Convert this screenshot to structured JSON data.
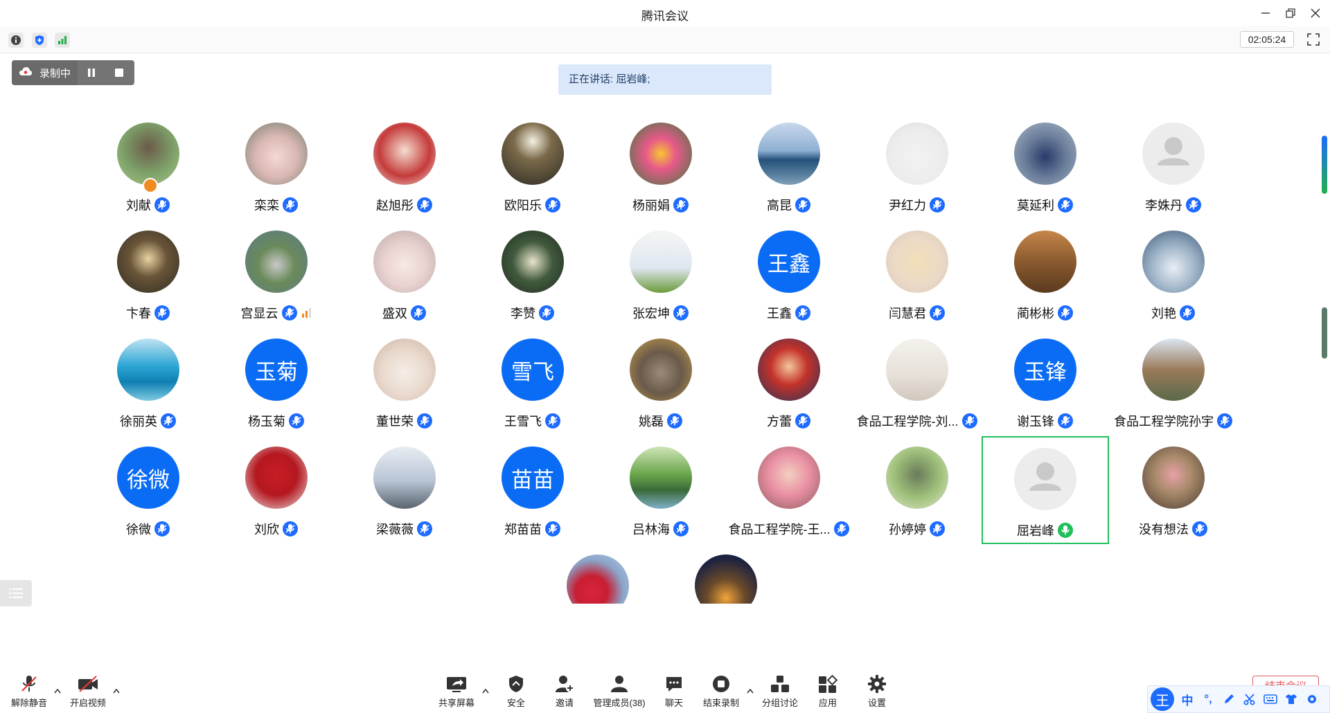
{
  "window": {
    "title": "腾讯会议"
  },
  "toolbar": {
    "timer": "02:05:24"
  },
  "recording": {
    "label": "录制中"
  },
  "speaking": {
    "text": "正在讲话: 屈岩峰;"
  },
  "participants": [
    {
      "name": "刘献"
    },
    {
      "name": "栾栾"
    },
    {
      "name": "赵旭彤"
    },
    {
      "name": "欧阳乐"
    },
    {
      "name": "杨丽娟"
    },
    {
      "name": "高昆"
    },
    {
      "name": "尹红力"
    },
    {
      "name": "莫延利"
    },
    {
      "name": "李姝丹"
    },
    {
      "name": "卞春"
    },
    {
      "name": "宫显云"
    },
    {
      "name": "盛双"
    },
    {
      "name": "李赞"
    },
    {
      "name": "张宏坤"
    },
    {
      "name": "王鑫",
      "avatar_text": "王鑫"
    },
    {
      "name": "闫慧君"
    },
    {
      "name": "蔺彬彬"
    },
    {
      "name": "刘艳"
    },
    {
      "name": "徐丽英"
    },
    {
      "name": "杨玉菊",
      "avatar_text": "玉菊"
    },
    {
      "name": "董世荣"
    },
    {
      "name": "王雪飞",
      "avatar_text": "雪飞"
    },
    {
      "name": "姚磊"
    },
    {
      "name": "方蕾"
    },
    {
      "name": "食品工程学院-刘..."
    },
    {
      "name": "谢玉锋",
      "avatar_text": "玉锋"
    },
    {
      "name": "食品工程学院孙宇"
    },
    {
      "name": "徐微",
      "avatar_text": "徐微"
    },
    {
      "name": "刘欣"
    },
    {
      "name": "梁薇薇"
    },
    {
      "name": "郑苗苗",
      "avatar_text": "苗苗"
    },
    {
      "name": "吕林海"
    },
    {
      "name": "食品工程学院-王..."
    },
    {
      "name": "孙婷婷"
    },
    {
      "name": "屈岩峰"
    },
    {
      "name": "没有想法"
    }
  ],
  "bottom": {
    "unmute": "解除静音",
    "start_video": "开启视频",
    "share_screen": "共享屏幕",
    "security": "安全",
    "invite": "邀请",
    "manage_members": "管理成员(38)",
    "chat": "聊天",
    "end_recording": "结束录制",
    "breakout": "分组讨论",
    "apps": "应用",
    "settings": "设置",
    "end_meeting": "结束会议"
  },
  "ime": {
    "logo": "王",
    "mode": "中",
    "punct": "°,"
  },
  "colors": {
    "accent": "#0a6cf5",
    "active_border": "#1fbf59",
    "speaking_bg": "#dbe8fb",
    "mic_blue": "#1e6bff",
    "mic_green": "#1fbf59",
    "signal": "#f08b22"
  }
}
